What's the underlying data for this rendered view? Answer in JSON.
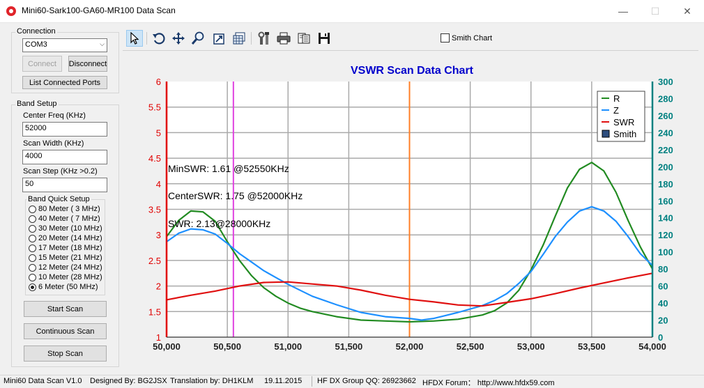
{
  "window": {
    "title": "Mini60-Sark100-GA60-MR100 Data Scan",
    "minimize_glyph": "—",
    "maximize_glyph": "☐",
    "close_glyph": "✕"
  },
  "connection": {
    "group_label": "Connection",
    "port_value": "COM3",
    "connect_label": "Connect",
    "disconnect_label": "Disconnect",
    "list_ports_label": "List Connected Ports"
  },
  "band_setup": {
    "group_label": "Band Setup",
    "center_freq_label": "Center Freq  (KHz)",
    "center_freq_value": "52000",
    "scan_width_label": "Scan Width    (KHz)",
    "scan_width_value": "4000",
    "scan_step_label": "Scan Step      (KHz >0.2)",
    "scan_step_value": "50",
    "quick_setup_label": "Band Quick Setup",
    "bands": [
      {
        "label": "80 Meter (  3 MHz)",
        "selected": false
      },
      {
        "label": "40 Meter (  7 MHz)",
        "selected": false
      },
      {
        "label": "30 Meter (10 MHz)",
        "selected": false
      },
      {
        "label": "20 Meter (14 MHz)",
        "selected": false
      },
      {
        "label": "17 Meter (18 MHz)",
        "selected": false
      },
      {
        "label": "15 Meter (21 MHz)",
        "selected": false
      },
      {
        "label": "12 Meter (24 MHz)",
        "selected": false
      },
      {
        "label": "10 Meter (28 MHz)",
        "selected": false
      },
      {
        "label": "6 Meter  (50 MHz)",
        "selected": true
      }
    ],
    "start_scan_label": "Start Scan",
    "continuous_scan_label": "Continuous Scan",
    "stop_scan_label": "Stop Scan"
  },
  "toolbar": {
    "icons": [
      "pointer-icon",
      "rotate-icon",
      "move-icon",
      "zoom-icon",
      "export-image-icon",
      "data-table-icon",
      "settings-tools-icon",
      "print-icon",
      "report-icon",
      "save-icon"
    ],
    "smith_chart_label": "Smith Chart"
  },
  "status": {
    "version": "Mini60 Data Scan V1.0",
    "designed_by": "Designed By: BG2JSX",
    "translation": "Translation by: DH1KLM",
    "date": "19.11.2015",
    "group": "HF DX Group QQ: 26923662",
    "forum": "HFDX Forum：  http://www.hfdx59.com"
  },
  "colors": {
    "r": "#228b22",
    "z": "#1e90ff",
    "swr": "#e01010",
    "left_axis": "#e00000",
    "right_axis": "#008080",
    "title": "#0000cc",
    "min_marker": "#e040e0",
    "center_marker": "#ff7f27"
  },
  "chart_data": {
    "type": "line",
    "title": "VSWR Scan Data Chart",
    "x_ticks": [
      "50,000",
      "50,500",
      "51,000",
      "51,500",
      "52,000",
      "52,500",
      "53,000",
      "53,500",
      "54,000"
    ],
    "y_left_ticks": [
      "1",
      "1.5",
      "2",
      "2.5",
      "3",
      "3.5",
      "4",
      "4.5",
      "5",
      "5.5",
      "6"
    ],
    "y_right_ticks": [
      "0",
      "20",
      "40",
      "60",
      "80",
      "100",
      "120",
      "140",
      "160",
      "180",
      "200",
      "220",
      "240",
      "260",
      "280",
      "300"
    ],
    "xlim": [
      50000,
      54000
    ],
    "ylim_left": [
      1,
      6
    ],
    "ylim_right": [
      0,
      300
    ],
    "legend": [
      {
        "name": "R"
      },
      {
        "name": "Z"
      },
      {
        "name": "SWR"
      },
      {
        "name": "Smith"
      }
    ],
    "legend_position": "top-right",
    "annotations": {
      "min_swr": "MinSWR: 1.61 @52550KHz",
      "center_swr": "CenterSWR: 1.75 @52000KHz",
      "swr_28000": "SWR: 2.13@28000KHz"
    },
    "markers": [
      {
        "name": "min-swr-marker",
        "x": 50550
      },
      {
        "name": "center-freq-marker",
        "x": 52000
      }
    ],
    "series": [
      {
        "name": "R",
        "axis": "right",
        "x": [
          50000,
          50100,
          50200,
          50300,
          50400,
          50500,
          50600,
          50700,
          50800,
          50900,
          51000,
          51100,
          51200,
          51400,
          51600,
          51800,
          52000,
          52200,
          52400,
          52600,
          52700,
          52800,
          52900,
          53000,
          53100,
          53200,
          53300,
          53400,
          53500,
          53600,
          53700,
          53800,
          53900,
          54000
        ],
        "values": [
          118,
          137,
          148,
          147,
          136,
          112,
          90,
          72,
          58,
          48,
          40,
          34,
          30,
          24,
          20,
          19,
          18,
          19,
          21,
          26,
          31,
          40,
          55,
          79,
          108,
          142,
          175,
          197,
          205,
          195,
          170,
          137,
          106,
          80
        ]
      },
      {
        "name": "Z",
        "axis": "right",
        "x": [
          50000,
          50100,
          50200,
          50300,
          50400,
          50500,
          50600,
          50700,
          50800,
          50900,
          51000,
          51200,
          51400,
          51600,
          51800,
          52000,
          52100,
          52200,
          52400,
          52600,
          52700,
          52800,
          52900,
          53000,
          53100,
          53200,
          53300,
          53400,
          53500,
          53600,
          53700,
          53800,
          53900,
          54000
        ],
        "values": [
          112,
          122,
          127,
          126,
          121,
          110,
          98,
          88,
          78,
          70,
          62,
          48,
          38,
          29,
          24,
          22,
          20,
          22,
          29,
          37,
          43,
          51,
          63,
          77,
          97,
          118,
          135,
          148,
          153,
          148,
          136,
          118,
          98,
          84
        ]
      },
      {
        "name": "SWR",
        "axis": "left",
        "x": [
          50000,
          50200,
          50400,
          50600,
          50800,
          51000,
          51200,
          51400,
          51600,
          51800,
          52000,
          52200,
          52400,
          52600,
          52800,
          53000,
          53200,
          53400,
          53600,
          53800,
          54000
        ],
        "values": [
          1.73,
          1.82,
          1.9,
          2.0,
          2.07,
          2.08,
          2.04,
          2.0,
          1.92,
          1.82,
          1.74,
          1.69,
          1.63,
          1.61,
          1.68,
          1.75,
          1.85,
          1.96,
          2.06,
          2.16,
          2.25
        ]
      }
    ]
  }
}
